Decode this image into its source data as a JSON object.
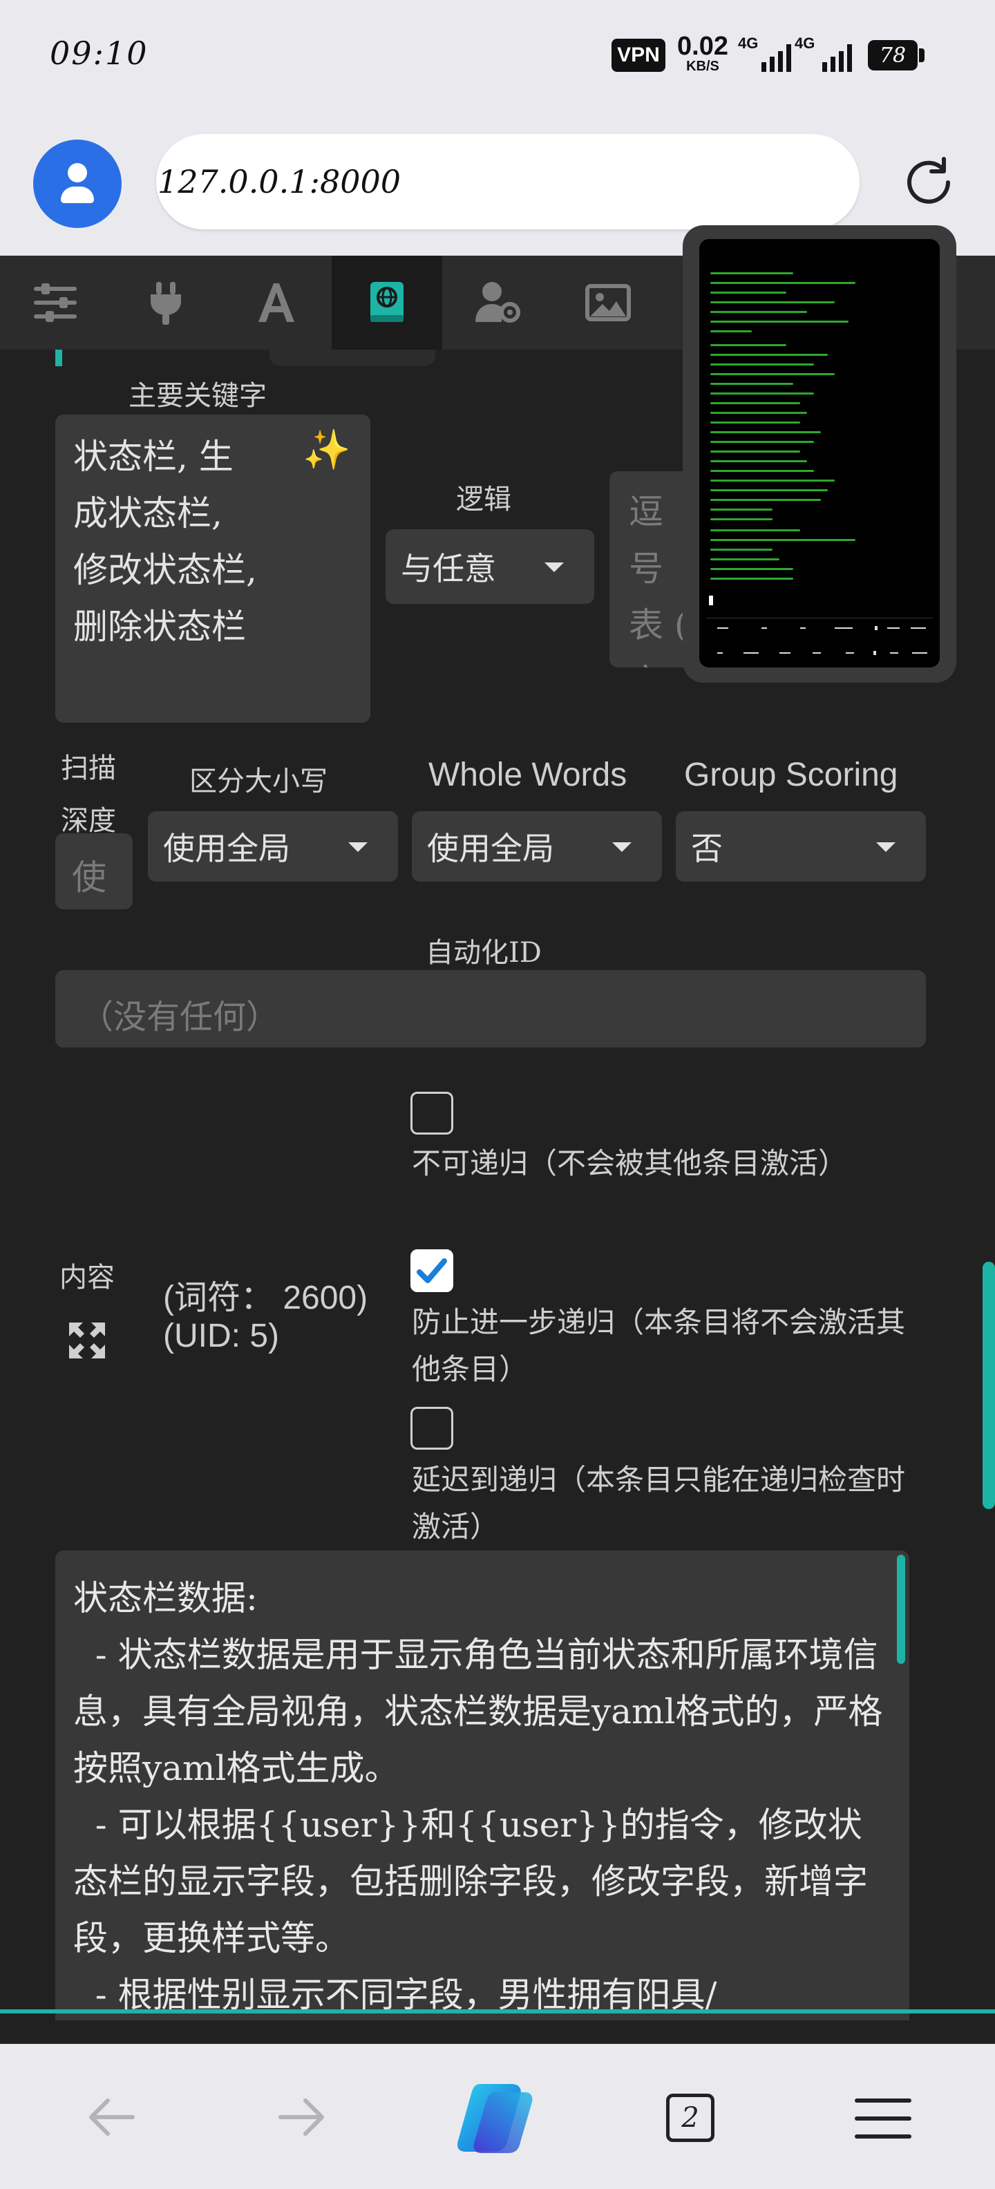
{
  "status_bar": {
    "time": "09:10",
    "vpn": "VPN",
    "speed_value": "0.02",
    "speed_unit": "KB/S",
    "net1": "4G",
    "net2": "4G",
    "battery": "78"
  },
  "browser": {
    "url": "127.0.0.1:8000"
  },
  "toolbar": {
    "icons": [
      "sliders-icon",
      "plug-icon",
      "font-icon",
      "book-globe-icon",
      "user-gear-icon",
      "image-icon"
    ],
    "active_index": 3,
    "accent": "#1db4a6"
  },
  "entry": {
    "primary_keywords_label": "主要关键字",
    "primary_keywords_value": "状态栏, 生\n成状态栏,\n修改状态栏,\n删除状态栏",
    "logic_label": "逻辑",
    "logic_value": "与任意",
    "secondary_keywords_value": "逗号\n表 (\n空则",
    "scan_depth_label": "扫描\n深度",
    "scan_depth_placeholder": "使",
    "case_sensitive_label": "区分大小写",
    "case_sensitive_value": "使用全局",
    "whole_words_label": "Whole Words",
    "whole_words_value": "使用全局",
    "group_scoring_label": "Group Scoring",
    "group_scoring_value": "否",
    "automation_id_label": "自动化ID",
    "automation_id_placeholder": "（没有任何）",
    "content_label": "内容",
    "token_info": "(词符：  2600)",
    "uid_info": "(UID: 5)",
    "options": [
      {
        "label": "不可递归（不会被其他条目激活）",
        "checked": false
      },
      {
        "label": "防止进一步递归（本条目将不会激活其他条目）",
        "checked": true
      },
      {
        "label": "延迟到递归（本条目只能在递归检查时激活）",
        "checked": false
      }
    ],
    "content_text": "状态栏数据:\n  - 状态栏数据是用于显示角色当前状态和所属环境信息，具有全局视角，状态栏数据是yaml格式的，严格按照yaml格式生成。\n  - 可以根据{{user}}和{{user}}的指令，修改状态栏的显示字段，包括删除字段，修改字段，新增字段，更换样式等。\n  - 根据性别显示不同字段，男性拥有阳具/"
  },
  "navbar": {
    "tab_count": "2"
  }
}
